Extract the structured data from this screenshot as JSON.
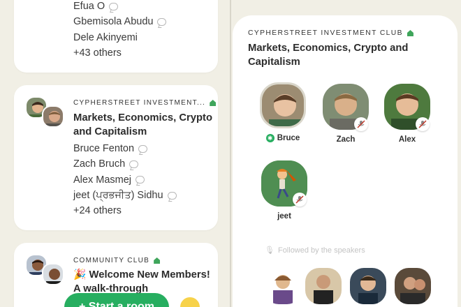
{
  "left_feed": {
    "cards": [
      {
        "speakers": [
          "Efua O",
          "Gbemisola Abudu",
          "Dele Akinyemi"
        ],
        "others": "+43 others"
      },
      {
        "club_name": "CYPHERSTREET INVESTMENT...",
        "title": "Markets, Economics, Crypto and Capitalism",
        "speakers": [
          "Bruce Fenton",
          "Zach Bruch",
          "Alex Masmej",
          "jeet (ਪ੍ਰਭਜੀਤ) Sidhu"
        ],
        "others": "+24 others"
      },
      {
        "club_name": "COMMUNITY CLUB",
        "title": "🎉 Welcome New Members! A walk-through"
      }
    ],
    "start_room_label": "+ Start a room"
  },
  "room": {
    "club_name": "CYPHERSTREET INVESTMENT CLUB",
    "title": "Markets, Economics, Crypto and Capitalism",
    "speakers": [
      {
        "name": "Bruce",
        "moderator": true,
        "muted": false
      },
      {
        "name": "Zach",
        "moderator": false,
        "muted": true
      },
      {
        "name": "Alex",
        "moderator": false,
        "muted": true
      },
      {
        "name": "jeet",
        "moderator": false,
        "muted": true
      }
    ],
    "followed_label": "Followed by the speakers"
  },
  "colors": {
    "background": "#f1efe5",
    "accent_green": "#27ae60",
    "club_house_green": "#3fa55b"
  }
}
